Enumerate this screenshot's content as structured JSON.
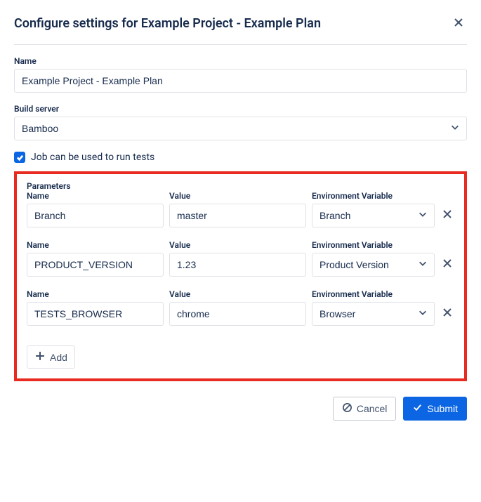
{
  "header": {
    "title": "Configure settings for Example Project - Example Plan"
  },
  "fields": {
    "name_label": "Name",
    "name_value": "Example Project - Example Plan",
    "build_server_label": "Build server",
    "build_server_value": "Bamboo",
    "checkbox_label": "Job can be used to run tests",
    "checkbox_checked": true
  },
  "parameters": {
    "section_label": "Parameters",
    "columns": {
      "name": "Name",
      "value": "Value",
      "env": "Environment Variable"
    },
    "rows": [
      {
        "name": "Branch",
        "value": "master",
        "env": "Branch"
      },
      {
        "name": "PRODUCT_VERSION",
        "value": "1.23",
        "env": "Product Version"
      },
      {
        "name": "TESTS_BROWSER",
        "value": "chrome",
        "env": "Browser"
      }
    ],
    "add_label": "Add"
  },
  "footer": {
    "cancel": "Cancel",
    "submit": "Submit"
  }
}
